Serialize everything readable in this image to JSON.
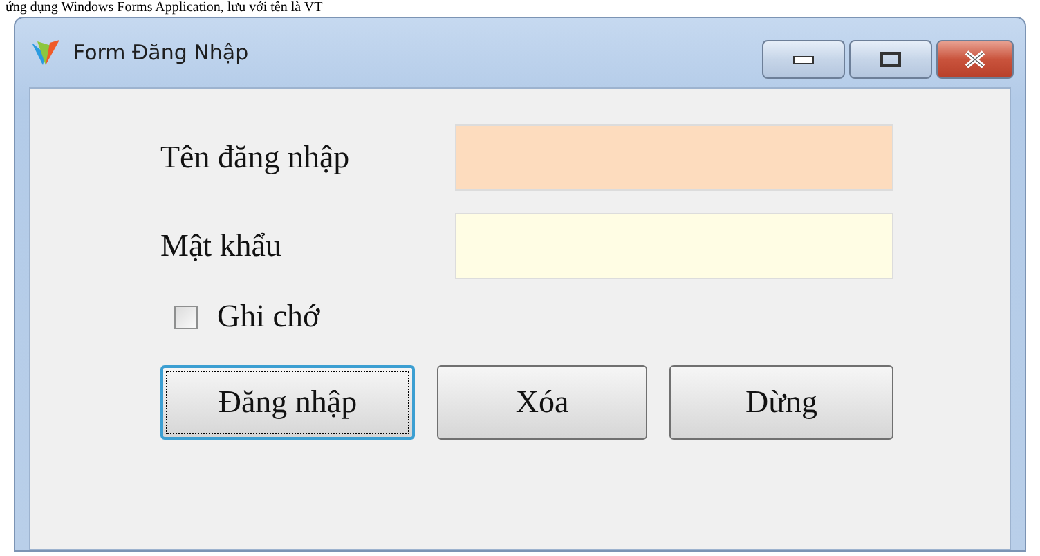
{
  "caption": "ứng dụng Windows Forms Application, lưu với tên là VT",
  "window": {
    "title": "Form Đăng Nhập"
  },
  "fields": [
    {
      "label": "Tên đăng nhập",
      "color": "#fddcbe"
    },
    {
      "label": "Mật khẩu",
      "color": "#fffde4"
    }
  ],
  "remember": {
    "label": "Ghi chớ",
    "checked": false
  },
  "buttons": [
    {
      "label": "Đăng nhập",
      "focused": true
    },
    {
      "label": "Xóa",
      "focused": false
    },
    {
      "label": "Dừng",
      "focused": false
    }
  ]
}
